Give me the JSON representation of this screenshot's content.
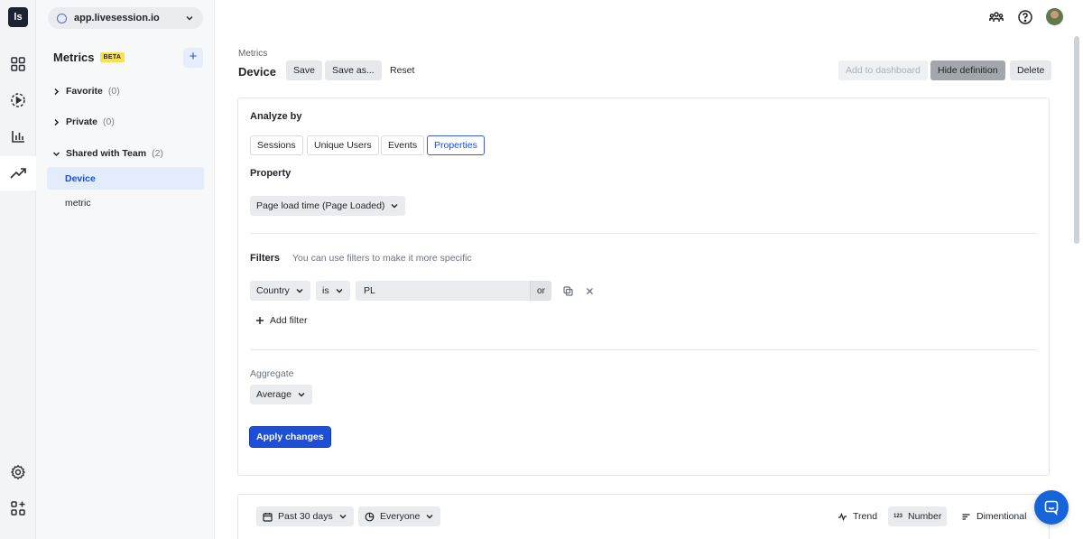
{
  "app": {
    "logo_text": "ls",
    "domain": "app.livesession.io"
  },
  "sidebar": {
    "title": "Metrics",
    "badge": "BETA",
    "add_label": "+",
    "folders": [
      {
        "label": "Favorite",
        "count": "(0)"
      },
      {
        "label": "Private",
        "count": "(0)"
      },
      {
        "label": "Shared with Team",
        "count": "(2)"
      }
    ],
    "items": [
      {
        "label": "Device"
      },
      {
        "label": "metric"
      }
    ]
  },
  "header": {
    "breadcrumb": "Metrics",
    "title": "Device",
    "save": "Save",
    "save_as": "Save as...",
    "reset": "Reset",
    "add_to_dashboard": "Add to dashboard",
    "hide_definition": "Hide definition",
    "delete": "Delete"
  },
  "definition": {
    "analyze_by_label": "Analyze by",
    "analyze_tabs": [
      "Sessions",
      "Unique Users",
      "Events",
      "Properties"
    ],
    "selected_tab": "Properties",
    "property_label": "Property",
    "property_value": "Page load time (Page Loaded)",
    "filters_label": "Filters",
    "filters_hint": "You can use filters to make it more specific",
    "filter": {
      "field": "Country",
      "operator": "is",
      "value": "PL",
      "or_label": "or"
    },
    "add_filter": "Add filter",
    "aggregate_label": "Aggregate",
    "aggregate_value": "Average",
    "apply": "Apply changes"
  },
  "results": {
    "date_range": "Past 30 days",
    "segment": "Everyone",
    "views": [
      "Trend",
      "Number",
      "Dimentional"
    ],
    "selected_view": "Number"
  },
  "colors": {
    "accent": "#1d4ed8",
    "beta": "#fde047",
    "chat": "#1565d8"
  }
}
